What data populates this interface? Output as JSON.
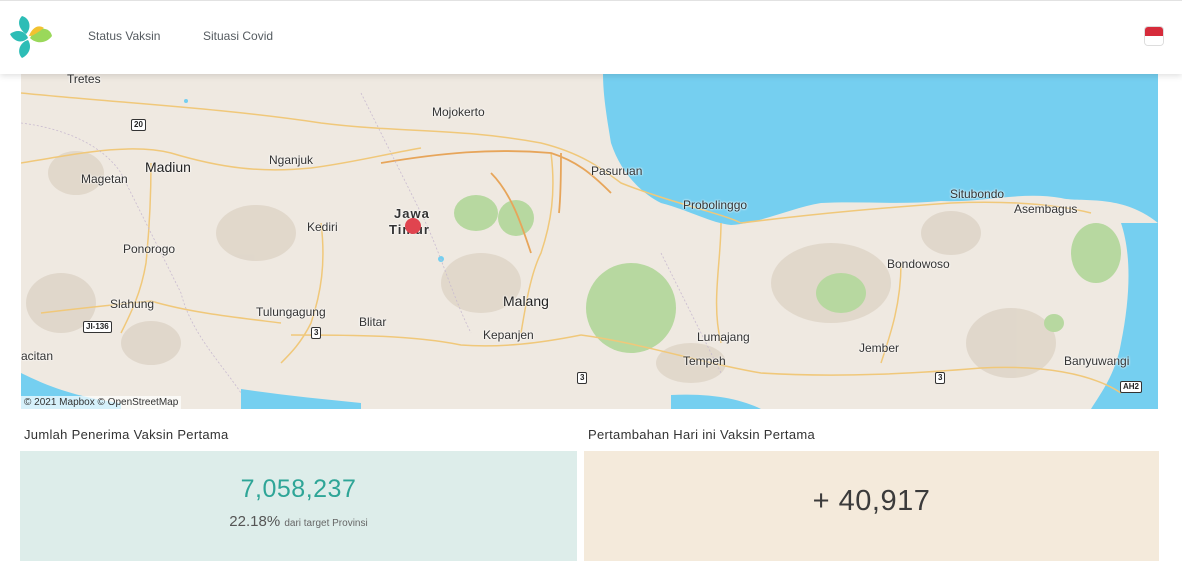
{
  "nav": {
    "links": [
      "Status Vaksin",
      "Situasi Covid"
    ]
  },
  "map": {
    "labels": {
      "trenggalek": "Tretes",
      "mojokerto": "Mojokerto",
      "madiun": "Madiun",
      "nganjuk": "Nganjuk",
      "magetan": "Magetan",
      "kediri": "Kediri",
      "ponorogo": "Ponorogo",
      "slahung": "Slahung",
      "tulungagung": "Tulungagung",
      "blitar": "Blitar",
      "pacitan": "acitan",
      "malang": "Malang",
      "kepanjen": "Kepanjen",
      "pasuruan": "Pasuruan",
      "probolinggo": "Probolinggo",
      "situbondo": "Situbondo",
      "asembagus": "Asembagus",
      "bondowoso": "Bondowoso",
      "lumajang": "Lumajang",
      "tempeh": "Tempeh",
      "jember": "Jember",
      "banyuwangi": "Banyuwangi",
      "province_line1": "Jawa",
      "province_line2": "Timur"
    },
    "shields": [
      "20",
      "JI-136",
      "3",
      "3",
      "3",
      "AH2"
    ],
    "attribution": "© 2021 Mapbox  © OpenStreetMap"
  },
  "panels": {
    "first_title": "Jumlah Penerima Vaksin Pertama",
    "first_value": "7,058,237",
    "first_percent": "22.18%",
    "first_note": "dari target Provinsi",
    "second_title": "Pertambahan Hari ini Vaksin Pertama",
    "second_value": "+ 40,917"
  },
  "colors": {
    "accent_teal": "#2ea597",
    "card1_bg": "#ddedea",
    "card2_bg": "#f4eadb",
    "map_water": "#75cff0",
    "map_land": "#efe9e1",
    "marker": "#e0444f"
  },
  "icons": {
    "logo": "kemenkes-logo",
    "flag": "indonesia-flag-icon"
  }
}
